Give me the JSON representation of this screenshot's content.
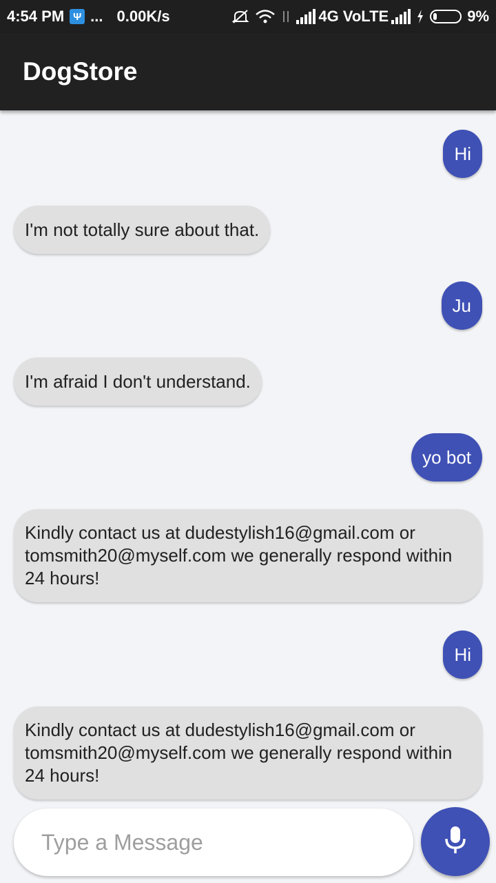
{
  "status_bar": {
    "time": "4:54 PM",
    "usb_icon": "usb-icon",
    "more": "...",
    "speed": "0.00K/s",
    "network": "4G VoLTE",
    "battery": "9%"
  },
  "app": {
    "title": "DogStore"
  },
  "messages": [
    {
      "from": "user",
      "text": "Hi"
    },
    {
      "from": "bot",
      "text": "I'm not totally sure about that."
    },
    {
      "from": "user",
      "text": "Ju"
    },
    {
      "from": "bot",
      "text": "I'm afraid I don't understand."
    },
    {
      "from": "user",
      "text": "yo bot"
    },
    {
      "from": "bot",
      "text": "Kindly contact us at dudestylish16@gmail.com or tomsmith20@myself.com we generally respond within 24 hours!"
    },
    {
      "from": "user",
      "text": "Hi"
    },
    {
      "from": "bot",
      "text": "Kindly contact us at dudestylish16@gmail.com or tomsmith20@myself.com we generally respond within 24 hours!"
    }
  ],
  "composer": {
    "placeholder": "Type a Message",
    "mic_icon": "mic-icon"
  },
  "colors": {
    "accent": "#3f51b5",
    "appbar": "#212121",
    "bot_bubble": "#e0e0e0",
    "background": "#f3f4f7"
  }
}
